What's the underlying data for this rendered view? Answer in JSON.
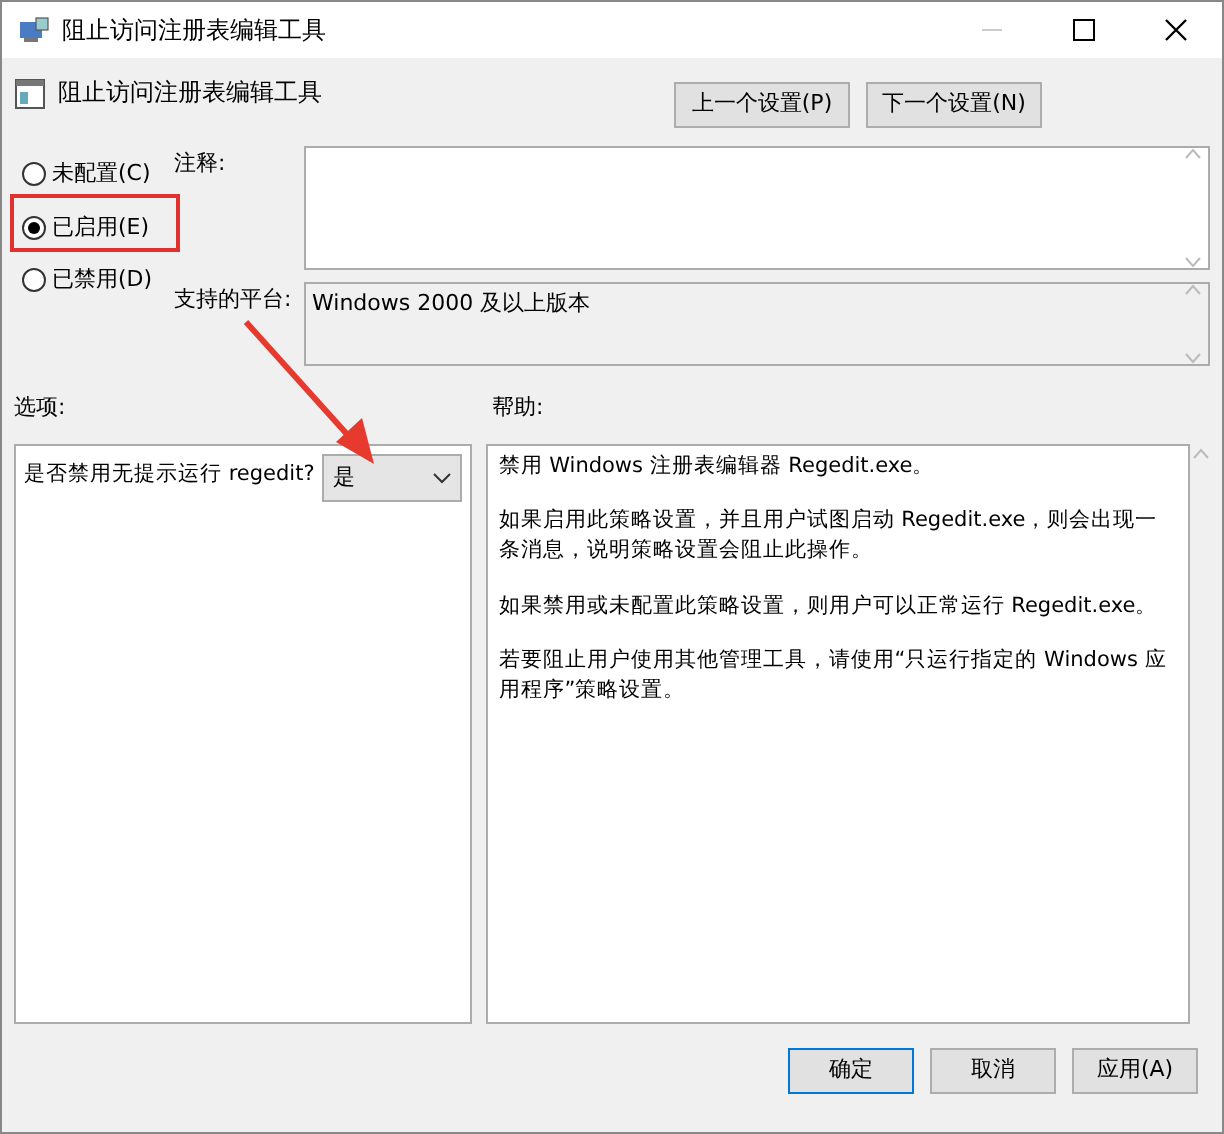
{
  "window": {
    "title": "阻止访问注册表编辑工具"
  },
  "header": {
    "title": "阻止访问注册表编辑工具",
    "buttons": [
      "上一个设置(P)",
      "下一个设置(N)"
    ]
  },
  "states": [
    {
      "label": "未配置(C)",
      "selected": false
    },
    {
      "label": "已启用(E)",
      "selected": true
    },
    {
      "label": "已禁用(D)",
      "selected": false
    }
  ],
  "comment": {
    "label": "注释:"
  },
  "platform": {
    "label": "支持的平台:",
    "value": "Windows 2000 及以上版本"
  },
  "options": {
    "label": "选项:",
    "setting": "是否禁用无提示运行 regedit?",
    "value": "是"
  },
  "help": {
    "label": "帮助:",
    "paragraphs": [
      "禁用 Windows 注册表编辑器 Regedit.exe。",
      "如果启用此策略设置，并且用户试图启动 Regedit.exe，则会出现一条消息，说明策略设置会阻止此操作。",
      "如果禁用或未配置此策略设置，则用户可以正常运行 Regedit.exe。",
      "若要阻止用户使用其他管理工具，请使用“只运行指定的 Windows 应用程序”策略设置。"
    ]
  },
  "buttons": [
    {
      "label": "确定",
      "default": true
    },
    {
      "label": "取消",
      "default": false
    },
    {
      "label": "应用(A)",
      "default": false
    }
  ]
}
